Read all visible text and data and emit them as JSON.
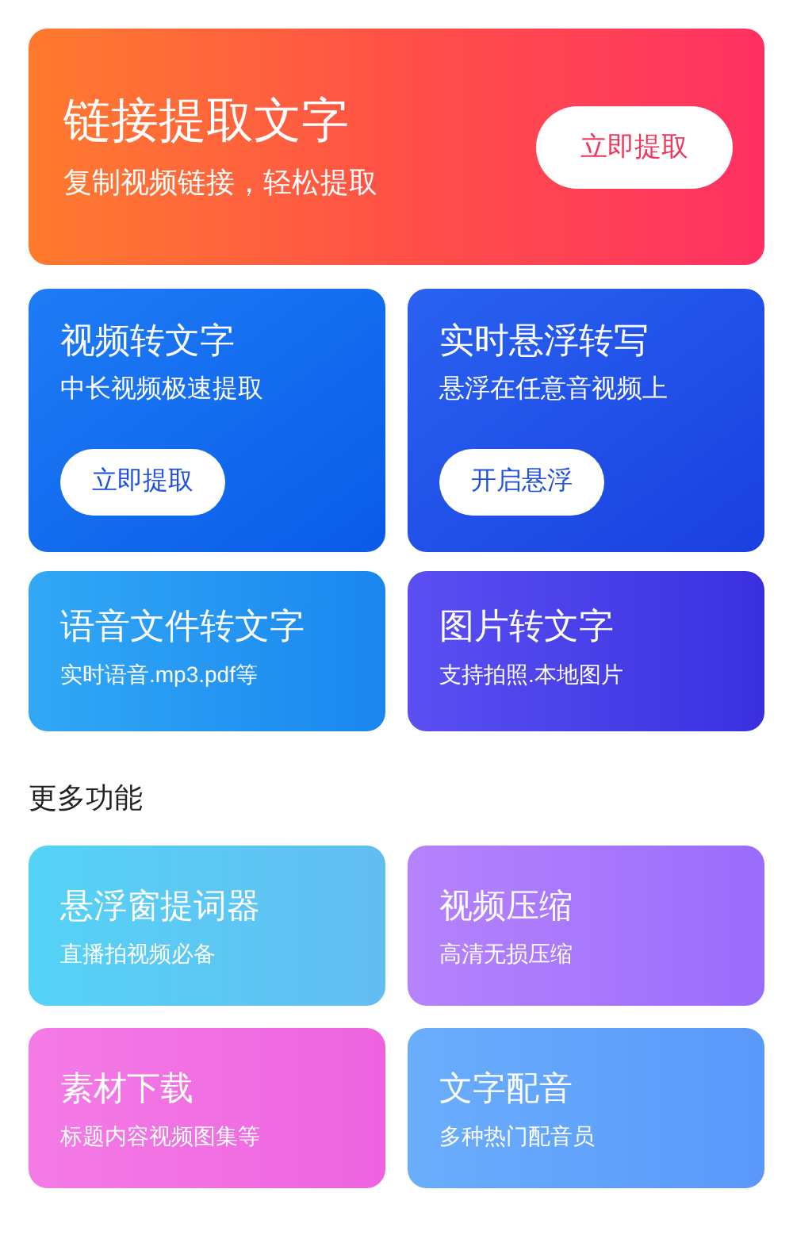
{
  "hero": {
    "title": "链接提取文字",
    "subtitle": "复制视频链接，轻松提取",
    "button": "立即提取"
  },
  "tools": [
    {
      "kind": "action",
      "title": "视频转文字",
      "subtitle": "中长视频极速提取",
      "button": "立即提取"
    },
    {
      "kind": "action",
      "title": "实时悬浮转写",
      "subtitle": "悬浮在任意音视频上",
      "button": "开启悬浮"
    },
    {
      "kind": "plain",
      "title": "语音文件转文字",
      "subtitle": "实时语音.mp3.pdf等"
    },
    {
      "kind": "plain",
      "title": "图片转文字",
      "subtitle": "支持拍照.本地图片"
    }
  ],
  "more": {
    "heading": "更多功能",
    "items": [
      {
        "title": "悬浮窗提词器",
        "subtitle": "直播拍视频必备"
      },
      {
        "title": "视频压缩",
        "subtitle": "高清无损压缩"
      },
      {
        "title": "素材下载",
        "subtitle": "标题内容视频图集等"
      },
      {
        "title": "文字配音",
        "subtitle": "多种热门配音员"
      }
    ]
  }
}
